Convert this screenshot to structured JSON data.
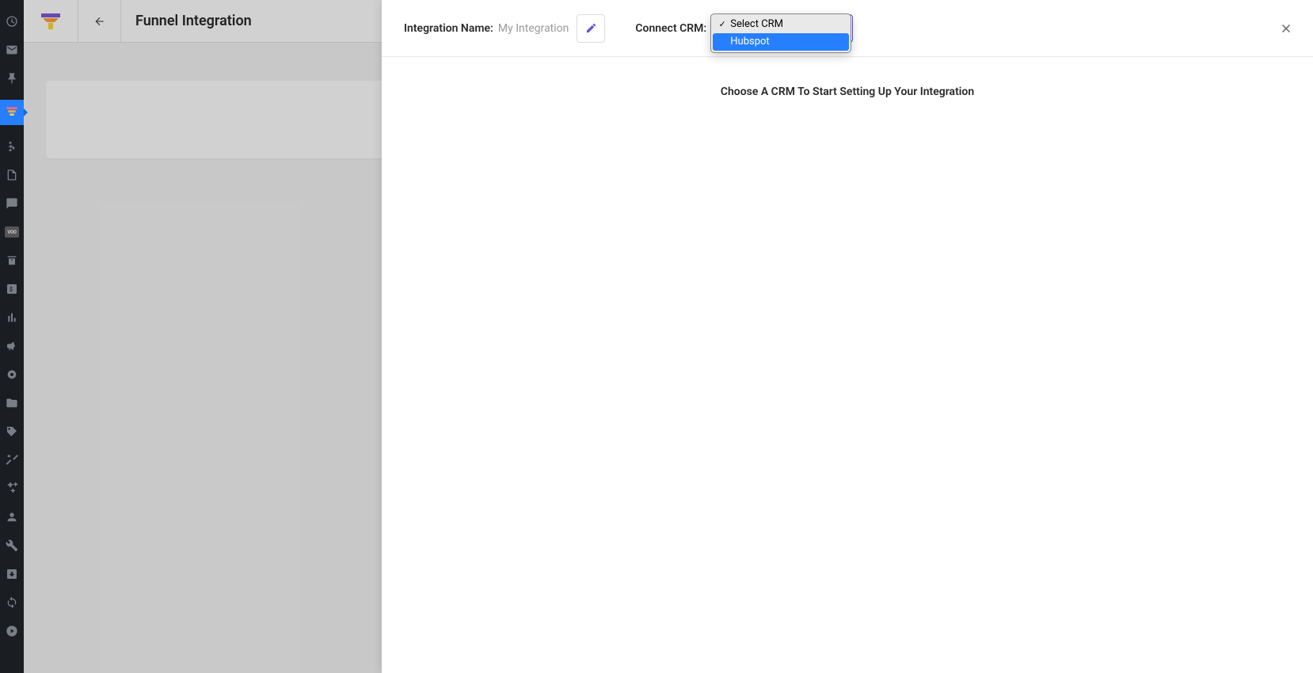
{
  "background": {
    "pageTitle": "Funnel Integration"
  },
  "modal": {
    "integrationNameLabel": "Integration Name:",
    "integrationNameValue": "My Integration",
    "connectCrmLabel": "Connect CRM:",
    "bodyMessage": "Choose A CRM To Start Setting Up Your Integration"
  },
  "dropdown": {
    "selected": "Select CRM",
    "options": [
      {
        "label": "Select CRM",
        "checked": true,
        "highlighted": false
      },
      {
        "label": "Hubspot",
        "checked": false,
        "highlighted": true
      }
    ]
  },
  "sidebar": {
    "vooLabel": "VOO"
  }
}
